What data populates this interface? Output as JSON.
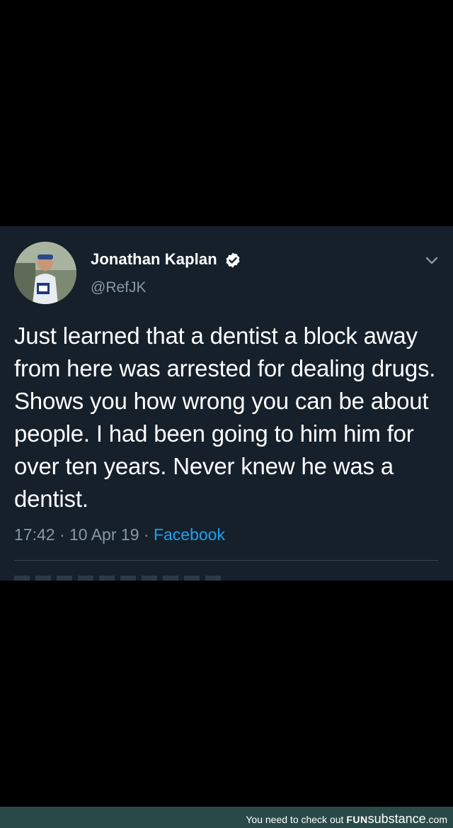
{
  "tweet": {
    "display_name": "Jonathan Kaplan",
    "handle": "@RefJK",
    "verified": true,
    "verified_icon": "verified-badge-icon",
    "menu_icon": "chevron-down-icon",
    "text": "Just learned that a dentist a block away from here was arrested for dealing drugs. Shows you how wrong you can be about people. I had been going to him him for over ten years. Never knew he was a dentist.",
    "time": "17:42",
    "separator": " · ",
    "date": "10 Apr 19",
    "source": "Facebook"
  },
  "footer": {
    "prefix": "You need to check out ",
    "brand_fun": "FUN",
    "brand_substance": "substance",
    "brand_tld": ".com"
  },
  "colors": {
    "card_background": "#15202b",
    "primary_text": "#ffffff",
    "secondary_text": "#8899a6",
    "link": "#1da1f2",
    "page_background": "#000000",
    "footer_background": "#2a4a49"
  }
}
